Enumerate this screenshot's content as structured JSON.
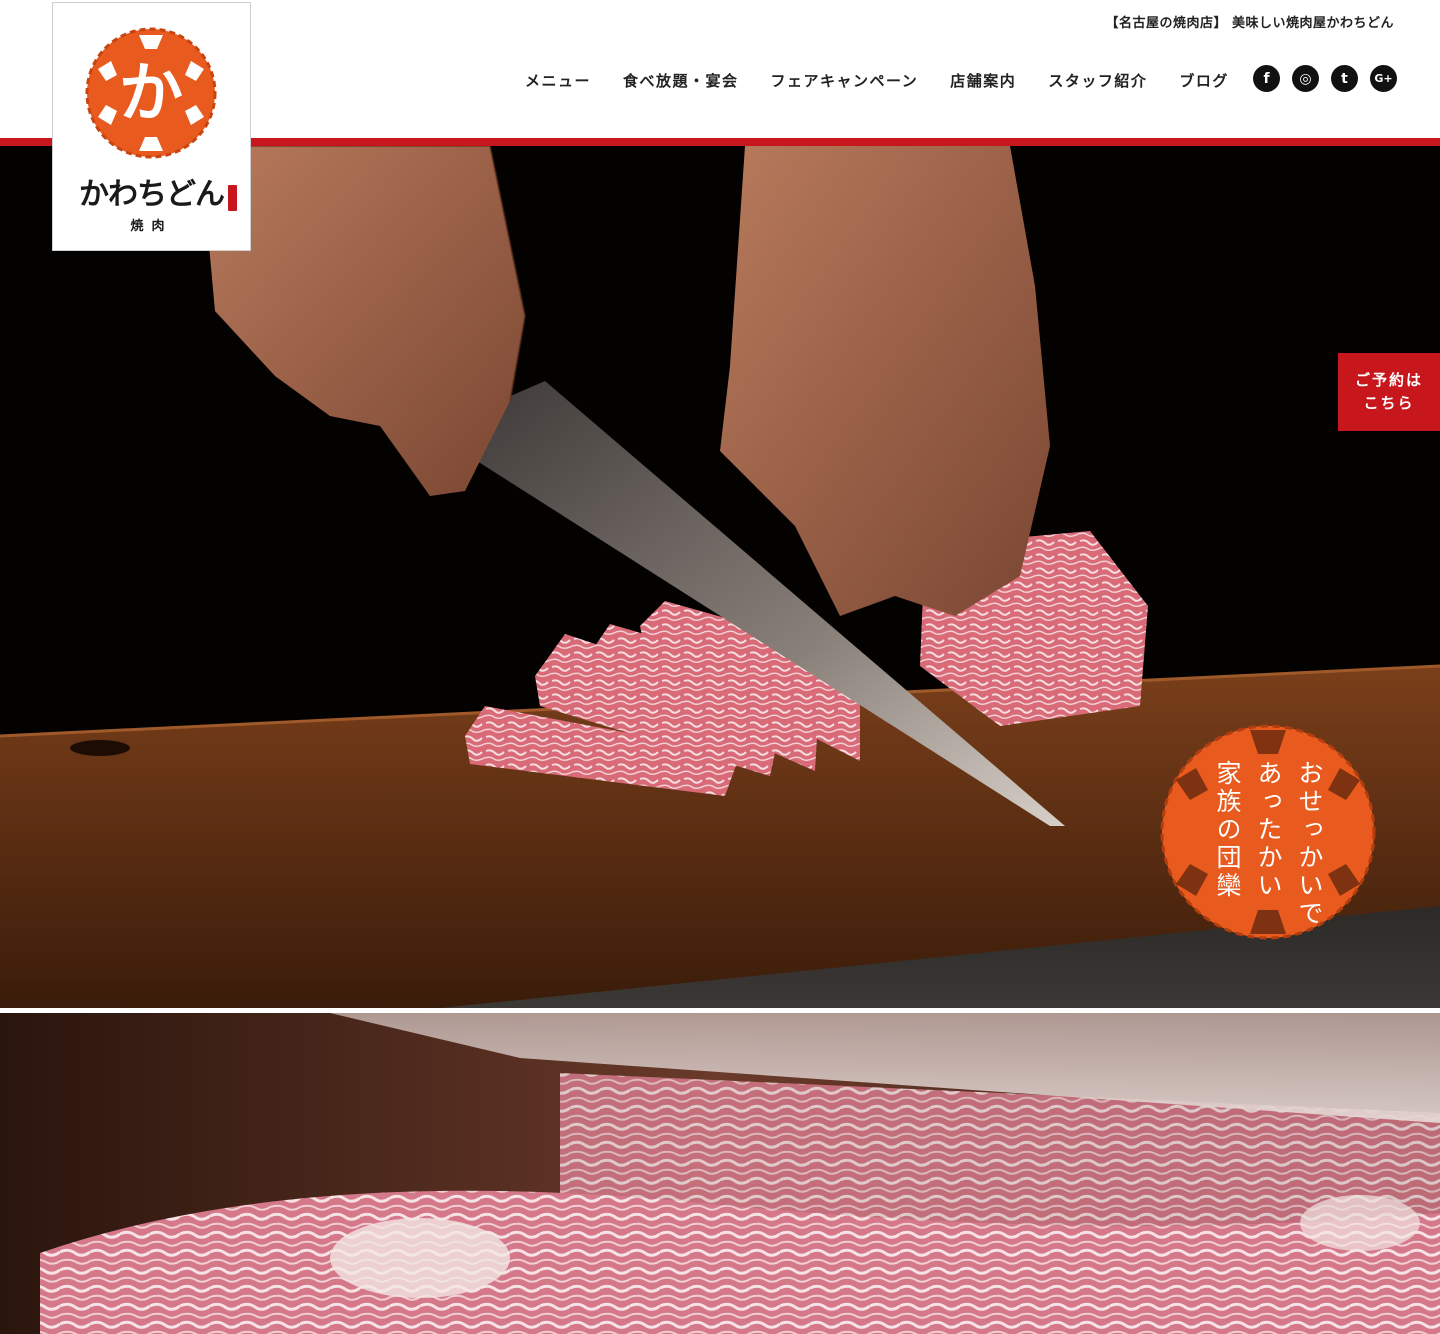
{
  "header": {
    "tagline": "【名古屋の焼肉店】 美味しい焼肉屋かわちどん",
    "nav": [
      {
        "label": "メニュー"
      },
      {
        "label": "食べ放題・宴会"
      },
      {
        "label": "フェアキャンペーン"
      },
      {
        "label": "店舗案内"
      },
      {
        "label": "スタッフ紹介"
      },
      {
        "label": "ブログ"
      }
    ],
    "socials": [
      {
        "name": "facebook-icon",
        "glyph": "f"
      },
      {
        "name": "instagram-icon",
        "glyph": "◎"
      },
      {
        "name": "twitter-icon",
        "glyph": "t"
      },
      {
        "name": "google-plus-icon",
        "glyph": "G+"
      }
    ]
  },
  "logo": {
    "brand": "かわちどん",
    "sub": "焼肉",
    "emblem_glyph": "か"
  },
  "reserve": {
    "line1": "ご予約は",
    "line2": "こちら"
  },
  "stamp": {
    "columns": [
      "おせっかいで",
      "あったかい",
      "家族の団欒"
    ]
  },
  "colors": {
    "brand_red": "#c8161d",
    "emblem_orange": "#e85a1d"
  }
}
